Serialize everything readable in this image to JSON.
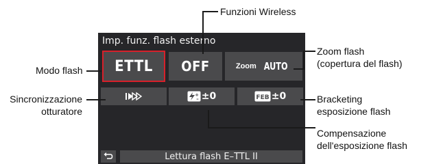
{
  "screen": {
    "title": "Imp. funz. flash esterno",
    "flash_mode": "ETTL",
    "wireless": "OFF",
    "zoom_word": "Zoom",
    "zoom_value": "AUTO",
    "comp_value": "±0",
    "feb_value": "±0",
    "footer_label": "Lettura flash E–TTL II",
    "highlight_color": "#d8202a"
  },
  "icons": {
    "sync": "second-curtain-sync-icon",
    "comp": "flash-exposure-compensation-icon",
    "feb": "feb-icon",
    "back": "return-icon"
  },
  "callouts": {
    "wireless": "Funzioni Wireless",
    "zoom_line1": "Zoom flash",
    "zoom_line2": "(copertura del flash)",
    "mode": "Modo flash",
    "sync_line1": "Sincronizzazione",
    "sync_line2": "otturatore",
    "bracket_line1": "Bracketing",
    "bracket_line2": "esposizione flash",
    "comp_line1": "Compensazione",
    "comp_line2": "dell'esposizione flash"
  }
}
